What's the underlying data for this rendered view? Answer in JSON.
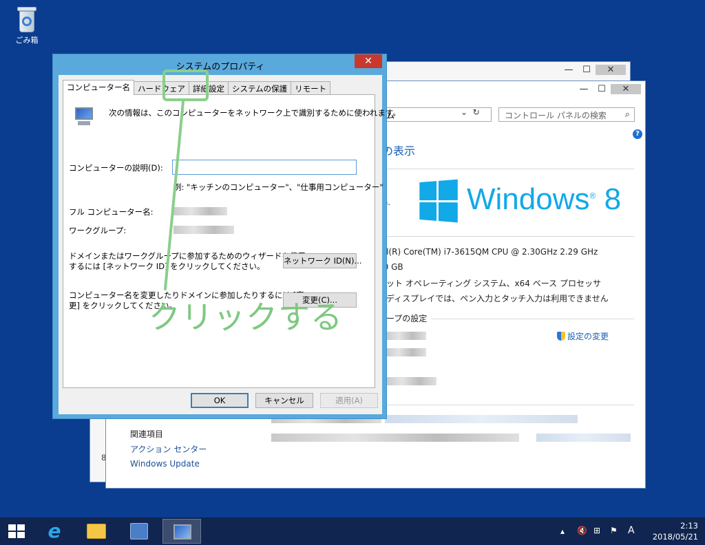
{
  "desktop": {
    "recycle_bin_label": "ごみ箱"
  },
  "background_window": {
    "title_fragment": "ム",
    "address": "ム",
    "search_placeholder": "コントロール パネルの検索",
    "view_title": "報の表示",
    "copyright_fragment": "on.",
    "windows_logo_text": "Windows",
    "windows_logo_version": "8",
    "processor": "tel(R) Core(TM) i7-3615QM CPU @ 2.30GHz   2.29 GHz",
    "memory": "00 GB",
    "system_type": "ビット オペレーティング システム、x64 ベース プロセッサ",
    "pen_touch": "のディスプレイでは、ペン入力とタッチ入力は利用できません",
    "group_title": "ループの設定",
    "change_settings_link": "設定の変更",
    "related_title": "関連項目",
    "related_links": [
      "アクション センター",
      "Windows Update"
    ],
    "back_window_fragment": "8"
  },
  "dialog": {
    "title": "システムのプロパティ",
    "close_glyph": "✕",
    "tabs": [
      "コンピューター名",
      "ハードウェア",
      "詳細設定",
      "システムの保護",
      "リモート"
    ],
    "active_tab": "コンピューター名",
    "intro_text": "次の情報は、このコンピューターをネットワーク上で識別するために使われます。",
    "description_label": "コンピューターの説明(D):",
    "description_value": "",
    "example_text": "例: \"キッチンのコンピューター\"、\"仕事用コンピューター\"",
    "full_name_label": "フル コンピューター名:",
    "workgroup_label": "ワークグループ:",
    "network_text_line1": "ドメインまたはワークグループに参加するためのウィザードを使用",
    "network_text_line2": "するには [ネットワーク ID] をクリックしてください。",
    "network_id_button": "ネットワーク ID(N)...",
    "rename_text_line1": "コンピューター名を変更したりドメインに参加したりするには [変",
    "rename_text_line2": "更] をクリックしてください。",
    "change_button": "変更(C)...",
    "ok_button": "OK",
    "cancel_button": "キャンセル",
    "apply_button": "適用(A)"
  },
  "annotation": {
    "text": "クリックする",
    "color": "#7fc881"
  },
  "taskbar": {
    "ime_indicator": "A",
    "time": "2:13",
    "date": "2018/05/21"
  },
  "colors": {
    "desktop": "#0a3d8f",
    "dialog_frame": "#5aa9dc",
    "close_button": "#c9382f",
    "windows_logo": "#11a9e8",
    "taskbar": "#10254f"
  }
}
